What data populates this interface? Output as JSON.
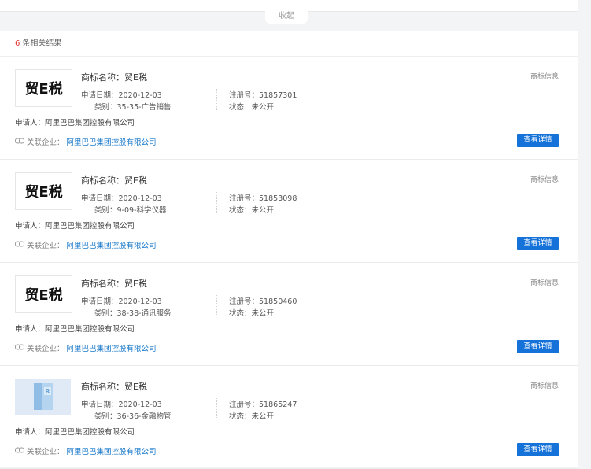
{
  "collapse_label": "收起",
  "result_count": {
    "num": "6",
    "text": "条相关结果"
  },
  "labels": {
    "name": "商标名称：",
    "date": "申请日期：",
    "cat": "类别：",
    "reg": "注册号：",
    "status": "状态：",
    "applicant": "申请人：",
    "related": "关联企业：",
    "tag": "商标信息",
    "button": "查看详情"
  },
  "cards": [
    {
      "logo_text": "贸E税",
      "logo_type": "text",
      "name": "贸E税",
      "date": "2020-12-03",
      "category": "35-35-广告销售",
      "reg_no": "51857301",
      "status": "未公开",
      "applicant": "阿里巴巴集团控股有限公司",
      "related": "阿里巴巴集团控股有限公司"
    },
    {
      "logo_text": "贸E税",
      "logo_type": "text",
      "name": "贸E税",
      "date": "2020-12-03",
      "category": "9-09-科学仪器",
      "reg_no": "51853098",
      "status": "未公开",
      "applicant": "阿里巴巴集团控股有限公司",
      "related": "阿里巴巴集团控股有限公司"
    },
    {
      "logo_text": "贸E税",
      "logo_type": "text",
      "name": "贸E税",
      "date": "2020-12-03",
      "category": "38-38-通讯服务",
      "reg_no": "51850460",
      "status": "未公开",
      "applicant": "阿里巴巴集团控股有限公司",
      "related": "阿里巴巴集团控股有限公司"
    },
    {
      "logo_text": "",
      "logo_type": "book-icon",
      "name": "贸E税",
      "date": "2020-12-03",
      "category": "36-36-金融物管",
      "reg_no": "51865247",
      "status": "未公开",
      "applicant": "阿里巴巴集团控股有限公司",
      "related": "阿里巴巴集团控股有限公司"
    }
  ]
}
